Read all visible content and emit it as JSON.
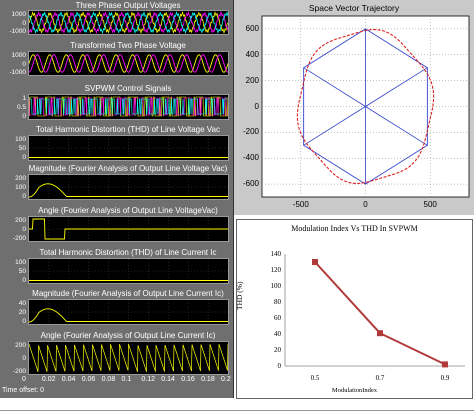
{
  "scope": {
    "time_offset": "Time offset:  0",
    "x_ticks": [
      "0",
      "0.02",
      "0.04",
      "0.06",
      "0.08",
      "0.1",
      "0.12",
      "0.14",
      "0.16",
      "0.18",
      "0.2"
    ],
    "panels": [
      {
        "title": "Three Phase Output Voltages",
        "yticks": [
          "1000",
          "0",
          "-1000"
        ],
        "signal": "three-phase-sine"
      },
      {
        "title": "Transformed Two Phase Voltage",
        "yticks": [
          "1000",
          "0",
          "-1000"
        ],
        "signal": "two-phase-sine"
      },
      {
        "title": "SVPWM Control Signals",
        "yticks": [
          "1",
          "0.5",
          "0"
        ],
        "signal": "pwm"
      },
      {
        "title": "Total Harmonic Distortion (THD) of Line Voltage Vac",
        "yticks": [
          "100",
          "50",
          "0"
        ],
        "signal": "flat"
      },
      {
        "title": "Magnitude (Fourier Analysis of Output Line Voltage Vac)",
        "yticks": [
          "200",
          "100",
          "0"
        ],
        "signal": "transient"
      },
      {
        "title": "Angle  (Fourier Analysis of Output Line VoltageVac)",
        "yticks": [
          "200",
          "0",
          "-200"
        ],
        "signal": "angle-step"
      },
      {
        "title": "Total Harmonic Distortion (THD) of Line Current Ic",
        "yticks": [
          "100",
          "50",
          "0"
        ],
        "signal": "flat"
      },
      {
        "title": "Magnitude (Fourier Analysis of Output Line Current Ic)",
        "yticks": [
          "40",
          "20",
          "0"
        ],
        "signal": "transient"
      },
      {
        "title": "Angle (Fourier Analysis of Output Line Current Ic)",
        "yticks": [
          "200",
          "0",
          "-200"
        ],
        "signal": "sawtooth"
      }
    ]
  },
  "chart_data": [
    {
      "type": "line",
      "title": "Space Vector Trajectory",
      "xlim": [
        -800,
        800
      ],
      "ylim": [
        -700,
        700
      ],
      "xticks": [
        "-500",
        "0",
        "500"
      ],
      "yticks": [
        "600",
        "400",
        "200",
        "0",
        "-200",
        "-400",
        "-600"
      ],
      "hexagon_radius": 600,
      "circle_radius": 520
    },
    {
      "type": "line",
      "title": "Modulation Index Vs THD In SVPWM",
      "xlabel": "ModulationIndex",
      "ylabel": "THD  (%)",
      "categories": [
        "0.5",
        "0.7",
        "0.9"
      ],
      "values": [
        130,
        41,
        2
      ],
      "ylim": [
        0,
        140
      ],
      "yticks": [
        "140",
        "120",
        "100",
        "80",
        "60",
        "40",
        "20",
        "0"
      ],
      "color": "#b03a3a"
    }
  ]
}
